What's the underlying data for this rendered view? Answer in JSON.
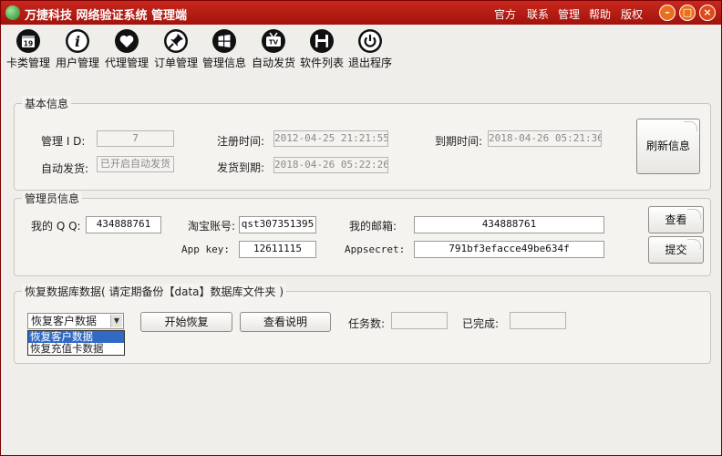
{
  "window": {
    "title": "万捷科技 网络验证系统 管理端",
    "menu": [
      "官方",
      "联系",
      "管理",
      "帮助",
      "版权"
    ]
  },
  "toolbar": {
    "items": [
      {
        "label": "卡类管理",
        "icon": "calendar-19-icon",
        "badge": "19"
      },
      {
        "label": "用户管理",
        "icon": "info-icon",
        "badge": "i"
      },
      {
        "label": "代理管理",
        "icon": "heart-icon"
      },
      {
        "label": "订单管理",
        "icon": "pin-icon"
      },
      {
        "label": "管理信息",
        "icon": "windows-icon"
      },
      {
        "label": "自动发货",
        "icon": "tv-icon",
        "badge": "TV"
      },
      {
        "label": "软件列表",
        "icon": "floppy-icon"
      },
      {
        "label": "退出程序",
        "icon": "power-icon"
      }
    ]
  },
  "basic_info": {
    "legend": "基本信息",
    "admin_id_label": "管理 I D:",
    "admin_id": "7",
    "register_time_label": "注册时间:",
    "register_time": "2012-04-25 21:21:55",
    "expire_time_label": "到期时间:",
    "expire_time": "2018-04-26 05:21:36",
    "auto_ship_label": "自动发货:",
    "auto_ship": "已开启自动发货",
    "ship_expire_label": "发货到期:",
    "ship_expire": "2018-04-26 05:22:26",
    "refresh_label": "刷新信息"
  },
  "admin_info": {
    "legend": "管理员信息",
    "qq_label": "我的 Q Q:",
    "qq": "434888761",
    "taobao_label": "淘宝账号:",
    "taobao": "qst307351395",
    "email_label": "我的邮箱:",
    "email": "434888761",
    "view_label": "查看",
    "appkey_label": "App key:",
    "appkey": "12611115",
    "appsecret_label": "Appsecret:",
    "appsecret": "791bf3efacce49be634f",
    "submit_label": "提交"
  },
  "restore": {
    "legend": "恢复数据库数据( 请定期备份【data】数据库文件夹 )",
    "selected": "恢复客户数据",
    "options": [
      "恢复客户数据",
      "恢复充值卡数据"
    ],
    "start_label": "开始恢复",
    "help_label": "查看说明",
    "tasks_label": "任务数:",
    "tasks": "",
    "done_label": "已完成:",
    "done": ""
  },
  "colors": {
    "titlebar": "#b51a12",
    "selection": "#316ac5"
  }
}
